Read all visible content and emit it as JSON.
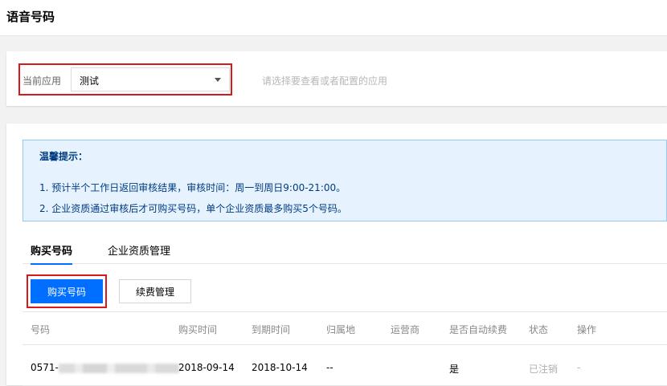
{
  "page": {
    "title": "语音号码"
  },
  "app_selector": {
    "label": "当前应用",
    "selected": "测试",
    "hint": "请选择要查看或者配置的应用"
  },
  "notice": {
    "title": "温馨提示：",
    "items": [
      "1. 预计半个工作日返回审核结果，审核时间：周一到周日9:00-21:00。",
      "2. 企业资质通过审核后才可购买号码，单个企业资质最多购买5个号码。"
    ]
  },
  "tabs": [
    {
      "label": "购买号码",
      "active": true
    },
    {
      "label": "企业资质管理",
      "active": false
    }
  ],
  "actions": {
    "buy_label": "购买号码",
    "renew_label": "续费管理"
  },
  "table": {
    "columns": [
      "号码",
      "购买时间",
      "到期时间",
      "归属地",
      "运营商",
      "是否自动续费",
      "状态",
      "操作"
    ],
    "rows": [
      {
        "number_prefix": "0571-",
        "purchase_time": "2018-09-14",
        "expire_time": "2018-10-14",
        "location": "--",
        "carrier": "",
        "auto_renew": "是",
        "status": "已注销",
        "operation": "-"
      }
    ]
  },
  "colors": {
    "accent": "#006eff",
    "highlight": "#d9181b",
    "notice_bg": "#e6f3ff"
  }
}
